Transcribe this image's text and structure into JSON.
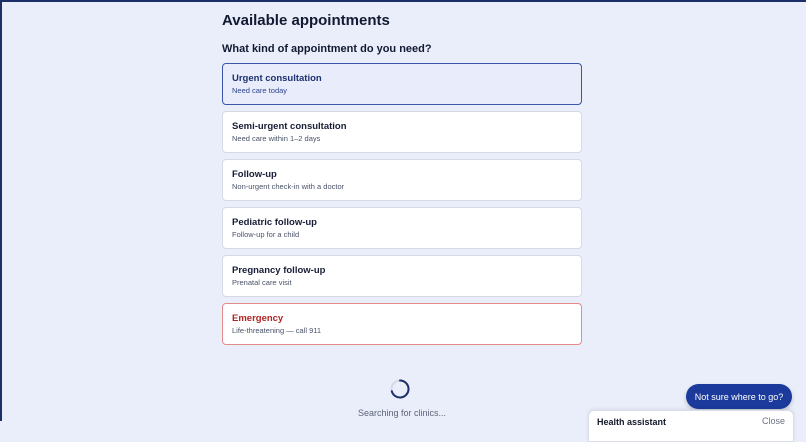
{
  "page": {
    "title": "Available appointments",
    "question": "What kind of appointment do you need?"
  },
  "options": [
    {
      "title": "Urgent consultation",
      "description": "Need care today",
      "state": "selected"
    },
    {
      "title": "Semi-urgent consultation",
      "description": "Need care within 1–2 days",
      "state": "default"
    },
    {
      "title": "Follow-up",
      "description": "Non-urgent check-in with a doctor",
      "state": "default"
    },
    {
      "title": "Pediatric follow-up",
      "description": "Follow-up for a child",
      "state": "default"
    },
    {
      "title": "Pregnancy follow-up",
      "description": "Prenatal care visit",
      "state": "default"
    },
    {
      "title": "Emergency",
      "description": "Life-threatening — call 911",
      "state": "emergency"
    }
  ],
  "loading": {
    "text": "Searching for clinics..."
  },
  "help": {
    "button_label": "Not sure where to go?"
  },
  "assistant": {
    "title": "Health assistant",
    "close_label": "Close"
  },
  "colors": {
    "background": "#eaeefa",
    "accent": "#1b3a9c",
    "selected_border": "#3b55a7",
    "emergency": "#b02525"
  },
  "icons": {
    "loading": "loading-spinner-icon"
  }
}
